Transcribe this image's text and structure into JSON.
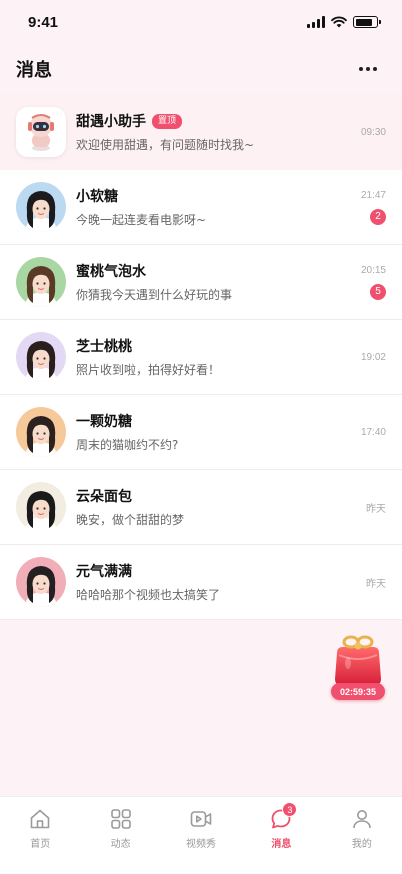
{
  "status_bar": {
    "time": "9:41"
  },
  "header": {
    "title": "消息"
  },
  "conversations": [
    {
      "name": "甜遇小助手",
      "badge": "置顶",
      "message": "欢迎使用甜遇，有问题随时找我~",
      "time": "09:30",
      "unread": null,
      "avatar": "robot-mascot",
      "bg": "#f6f6f6",
      "pinned": true
    },
    {
      "name": "小软糖",
      "message": "今晚一起连麦看电影呀~",
      "time": "21:47",
      "unread": "2",
      "avatar": "girl-portrait",
      "bg": "#bcd9f2"
    },
    {
      "name": "蜜桃气泡水",
      "message": "你猜我今天遇到什么好玩的事",
      "time": "20:15",
      "unread": "5",
      "avatar": "girl-portrait",
      "bg": "#a9d7a4"
    },
    {
      "name": "芝士桃桃",
      "message": "照片收到啦，拍得好好看！",
      "time": "19:02",
      "unread": null,
      "avatar": "girl-portrait",
      "bg": "#e4d9f5"
    },
    {
      "name": "一颗奶糖",
      "message": "周末的猫咖约不约?",
      "time": "17:40",
      "unread": null,
      "avatar": "girl-portrait",
      "bg": "#f6c99a"
    },
    {
      "name": "云朵面包",
      "message": "晚安，做个甜甜的梦",
      "time": "昨天",
      "unread": null,
      "avatar": "girl-portrait",
      "bg": "#f3ece0"
    },
    {
      "name": "元气满满",
      "message": "哈哈哈那个视频也太搞笑了",
      "time": "昨天",
      "unread": null,
      "avatar": "girl-portrait",
      "bg": "#f2aeb8"
    }
  ],
  "gift": {
    "timer": "02:59:35"
  },
  "tabbar": {
    "tabs": [
      {
        "label": "首页",
        "icon": "home-icon"
      },
      {
        "label": "动态",
        "icon": "grid-icon"
      },
      {
        "label": "视频秀",
        "icon": "video-icon"
      },
      {
        "label": "消息",
        "icon": "message-icon",
        "badge": "3",
        "active": true
      },
      {
        "label": "我的",
        "icon": "user-icon"
      }
    ]
  },
  "colors": {
    "accent": "#f0506e",
    "page_bg": "#fdf2f5"
  }
}
